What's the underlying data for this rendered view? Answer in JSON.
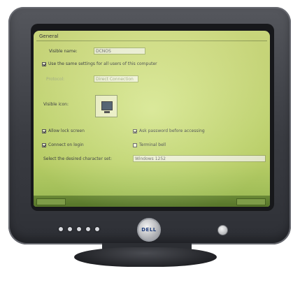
{
  "screen": {
    "tab_label": "General",
    "rows": [
      {
        "label": "Visible name:",
        "value": "DCNOS"
      },
      {
        "check_label": "Use the same settings for all users of this computer"
      },
      {
        "label": "Protocol:",
        "value": "Direct Connection"
      },
      {
        "label": "Visible icon:"
      }
    ],
    "checks": {
      "left1": "Allow lock screen",
      "right1": "Ask password before accessing",
      "left2": "Connect on login",
      "right2": "Terminal bell",
      "select_label": "Select the desired character set:",
      "select_value": "Windows 1252"
    }
  },
  "monitor": {
    "logo_text": "DELL",
    "front_button_count": 5
  }
}
